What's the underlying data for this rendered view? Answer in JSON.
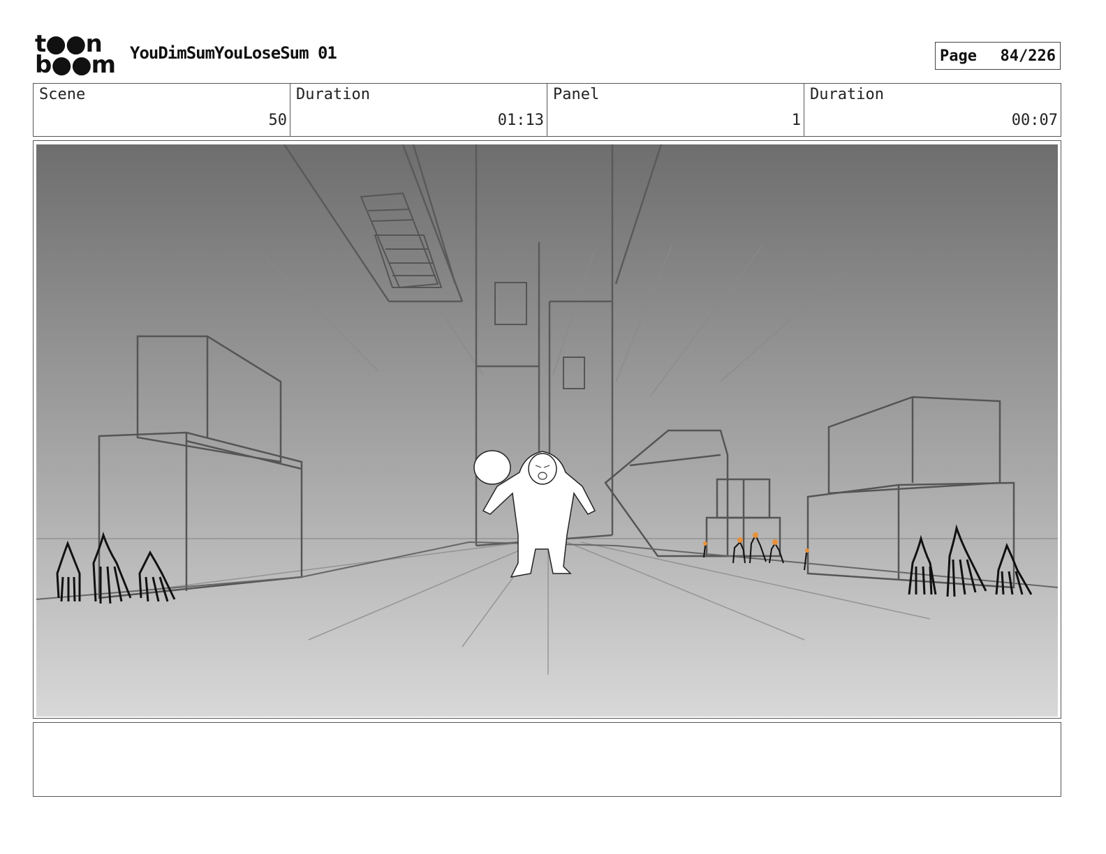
{
  "logo": {
    "line1": "t●●n",
    "line2": "b●●m",
    "alt": "toon boom"
  },
  "project": {
    "title": "YouDimSumYouLoseSum 01"
  },
  "page": {
    "label": "Page",
    "value": "84/226"
  },
  "info": {
    "scene": {
      "label": "Scene",
      "value": "50"
    },
    "scene_duration": {
      "label": "Duration",
      "value": "01:13"
    },
    "panel": {
      "label": "Panel",
      "value": "1"
    },
    "panel_duration": {
      "label": "Duration",
      "value": "00:07"
    }
  },
  "panel_image": {
    "icon": "storyboard-sketch-alley-icon"
  },
  "notes": {
    "text": ""
  },
  "colors": {
    "sky_top": "#6e6e6e",
    "ground_bottom": "#d6d6d6",
    "accent_orange": "#e8903a"
  }
}
